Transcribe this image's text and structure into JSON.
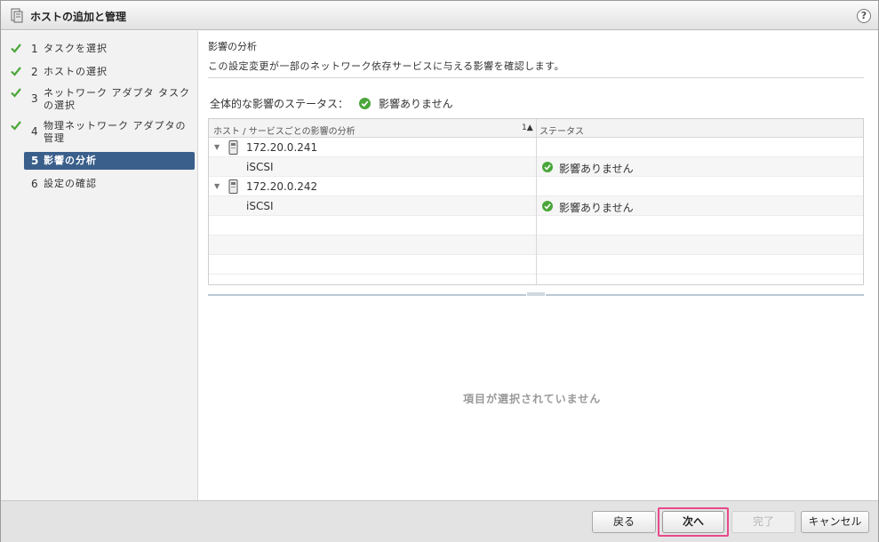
{
  "dialog": {
    "title": "ホストの追加と管理",
    "help_symbol": "?"
  },
  "steps": [
    {
      "num": "1",
      "label": "タスクを選択",
      "completed": true
    },
    {
      "num": "2",
      "label": "ホストの選択",
      "completed": true
    },
    {
      "num": "3",
      "label": "ネットワーク アダプタ タスクの選択",
      "completed": true
    },
    {
      "num": "4",
      "label": "物理ネットワーク アダプタの管理",
      "completed": true
    },
    {
      "num": "5",
      "label": "影響の分析",
      "active": true
    },
    {
      "num": "6",
      "label": "設定の確認"
    }
  ],
  "main": {
    "section_title": "影響の分析",
    "description": "この設定変更が一部のネットワーク依存サービスに与える影響を確認します。",
    "overall_label": "全体的な影響のステータス：",
    "overall_status": "影響ありません",
    "table": {
      "col1_header": "ホスト / サービスごとの影響の分析",
      "sort_indicator": "1▲",
      "col2_header": "ステータス",
      "rows": [
        {
          "type": "host",
          "name": "172.20.0.241"
        },
        {
          "type": "service",
          "name": "iSCSI",
          "status": "影響ありません"
        },
        {
          "type": "host",
          "name": "172.20.0.242"
        },
        {
          "type": "service",
          "name": "iSCSI",
          "status": "影響ありません"
        }
      ]
    },
    "empty_detail": "項目が選択されていません"
  },
  "footer": {
    "back_label": "戻る",
    "next_label": "次へ",
    "finish_label": "完了",
    "cancel_label": "キャンセル"
  },
  "colors": {
    "active_step": "#3a5f8b",
    "check_green": "#4aa63a",
    "highlight": "#e8498a"
  }
}
